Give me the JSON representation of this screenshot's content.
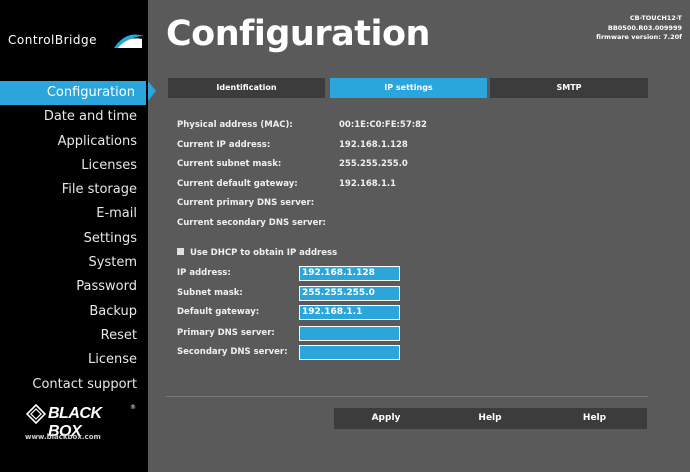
{
  "brand": {
    "name": "ControlBridge"
  },
  "sidebar": {
    "items": [
      {
        "label": "Configuration"
      },
      {
        "label": "Date and time"
      },
      {
        "label": "Applications"
      },
      {
        "label": "Licenses"
      },
      {
        "label": "File storage"
      },
      {
        "label": "E-mail"
      },
      {
        "label": "Settings"
      },
      {
        "label": "System"
      },
      {
        "label": "Password"
      },
      {
        "label": "Backup"
      },
      {
        "label": "Reset"
      },
      {
        "label": "License"
      },
      {
        "label": "Contact support"
      }
    ],
    "logo_text": "BLACK BOX",
    "logo_reg": "®",
    "url": "www.blackbox.com"
  },
  "header": {
    "title": "Configuration",
    "device_model": "CB-TOUCH12-T",
    "device_serial": "BB0500.R03.009999",
    "firmware": "firmware version: 7.20f"
  },
  "tabs": [
    {
      "label": "Identification"
    },
    {
      "label": "IP settings"
    },
    {
      "label": "SMTP"
    }
  ],
  "status": {
    "mac_label": "Physical address (MAC):",
    "mac_value": "00:1E:C0:FE:57:82",
    "ip_label": "Current IP address:",
    "ip_value": "192.168.1.128",
    "subnet_label": "Current subnet mask:",
    "subnet_value": "255.255.255.0",
    "gateway_label": "Current default gateway:",
    "gateway_value": "192.168.1.1",
    "dns1_label": "Current primary DNS server:",
    "dns2_label": "Current secondary DNS server:"
  },
  "form": {
    "dhcp_label": "Use DHCP to obtain IP address",
    "ip_label": "IP address:",
    "ip_value": "192.168.1.128",
    "subnet_label": "Subnet mask:",
    "subnet_value": "255.255.255.0",
    "gateway_label": "Default gateway:",
    "gateway_value": "192.168.1.1",
    "dns1_label": "Primary DNS server:",
    "dns1_value": "",
    "dns2_label": "Secondary DNS server:",
    "dns2_value": ""
  },
  "actions": {
    "apply": "Apply",
    "help1": "Help",
    "help2": "Help"
  },
  "colors": {
    "accent": "#2aa6dc",
    "panel": "#5a5a5a",
    "dark": "#3c3c3c"
  }
}
